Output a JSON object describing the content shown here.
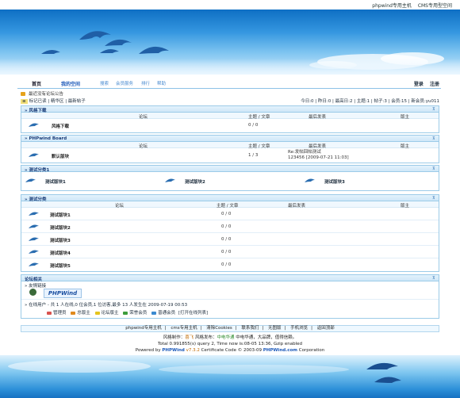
{
  "top_links": [
    "phpwind专用主机",
    "CMS专用型空间"
  ],
  "nav": {
    "home": "首页",
    "my_space": "我的空间",
    "small_links": [
      "搜索",
      "会员服务",
      "排行",
      "帮助"
    ],
    "login": "登录",
    "register": "注册"
  },
  "notice": "最近没有论坛公告",
  "crumbs": {
    "tags": [
      "标记已读",
      "精华区",
      "最新帖子"
    ],
    "text": "标记已读 | 精华区 | 最新帖子"
  },
  "stats": "今日:0 | 昨日:0 | 最高日:2 | 主题:1 | 帖子:3 | 会员:15 | 新会员:yu011",
  "columns": {
    "forum": "论坛",
    "topics": "主题 / 文章",
    "last_post": "最后发表",
    "moderator": "版主"
  },
  "sections": {
    "feng": {
      "title": "风格下载",
      "forums": [
        {
          "name": "风格下载",
          "count": "0 / 0"
        }
      ]
    },
    "board": {
      "title": "PHPwind Board",
      "forums": [
        {
          "name": "默认版块",
          "count": "1 / 3",
          "last_title": "Re:发帖回帖测试",
          "last_by": "123456 [2009-07-21 11:03]"
        }
      ]
    },
    "test1": {
      "title": "测试分类1",
      "forums": [
        "测试版块1",
        "测试版块2",
        "测试版块3"
      ]
    },
    "test": {
      "title": "测试分类",
      "forums": [
        {
          "name": "测试版块1",
          "count": "0 / 0"
        },
        {
          "name": "测试版块2",
          "count": "0 / 0"
        },
        {
          "name": "测试版块3",
          "count": "0 / 0"
        },
        {
          "name": "测试版块4",
          "count": "0 / 0"
        },
        {
          "name": "测试版块5",
          "count": "0 / 0"
        }
      ]
    },
    "related": {
      "title": "论坛相关",
      "friend_links": "友情链接",
      "logo_text": "PHPWind",
      "online": "在线用户 - 共 1 人在线,0 位会员,1 位访客,最多 13 人发生在 2009-07-19 00:53",
      "legend": [
        {
          "label": "管理员",
          "color": "#d9534f"
        },
        {
          "label": "总版主",
          "color": "#e08a1e"
        },
        {
          "label": "论坛版主",
          "color": "#e5c51e"
        },
        {
          "label": "荣誉会员",
          "color": "#3c9d3c"
        },
        {
          "label": "普通会员",
          "color": "#3a8ad0"
        }
      ],
      "show_list": "[打开在线列表]"
    }
  },
  "footer_links": [
    "phpwind专用主机",
    "cms专用主机",
    "清除Cookies",
    "联系我们",
    "无图版",
    "手机浏览",
    "返回顶部"
  ],
  "copyright": {
    "line1_a": "风格制作：",
    "line1_b": "喜飞",
    "line1_c": "风格发布：",
    "line1_d": "中电华通",
    "line1_e": "中电华通，大品牌，值得信赖。",
    "line2": "Total 0.991855(s) query 2, Time now is:08-05 13:36, Gzip enabled",
    "line3_a": "Powered by",
    "line3_b": "PHPWind",
    "line3_c": "v7.3.2",
    "line3_d": "Certificate Code © 2003-09",
    "line3_e": "PHPWind.com",
    "line3_f": "Corporation"
  }
}
